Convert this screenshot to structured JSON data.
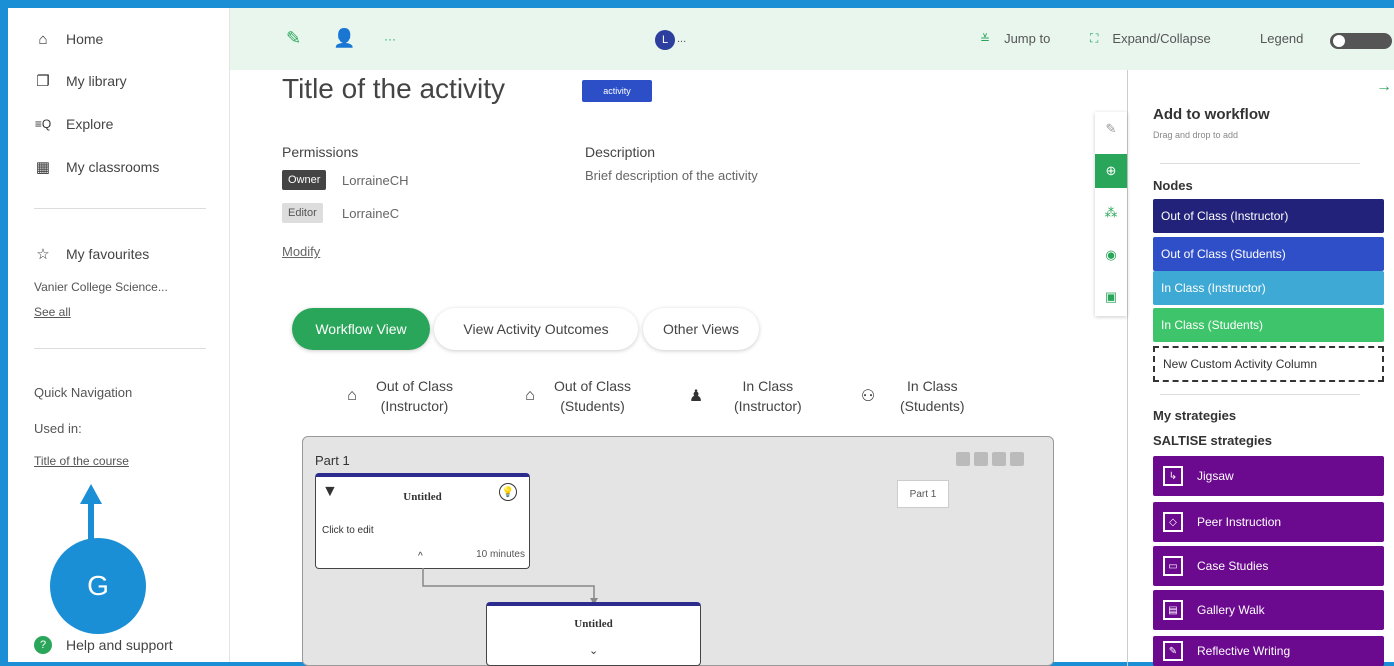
{
  "sidebar": {
    "items": [
      {
        "label": "Home",
        "icon": "home-icon"
      },
      {
        "label": "My library",
        "icon": "library-icon"
      },
      {
        "label": "Explore",
        "icon": "explore-icon"
      },
      {
        "label": "My classrooms",
        "icon": "calendar-icon"
      }
    ],
    "favourites_label": "My favourites",
    "favourite_item": "Vanier College Science...",
    "see_all": "See all",
    "quick_nav": "Quick Navigation",
    "used_in": "Used in:",
    "course_link": "Title of the course",
    "help": "Help and support"
  },
  "callout": {
    "letter": "G"
  },
  "toolbar": {
    "avatar_letter": "L",
    "avatar_more": "...",
    "jump_to": "Jump to",
    "expand_collapse": "Expand/Collapse",
    "legend": "Legend"
  },
  "main": {
    "title": "Title of the activity",
    "badge": "activity",
    "permissions_label": "Permissions",
    "description_label": "Description",
    "description": "Brief description of the activity",
    "owner_role": "Owner",
    "owner_name": "LorraineCH",
    "editor_role": "Editor",
    "editor_name": "LorraineC",
    "modify": "Modify",
    "tabs": [
      "Workflow View",
      "View Activity Outcomes",
      "Other Views"
    ],
    "columns": [
      {
        "line1": "Out of Class",
        "line2": "(Instructor)"
      },
      {
        "line1": "Out of Class",
        "line2": "(Students)"
      },
      {
        "line1": "In Class",
        "line2": "(Instructor)"
      },
      {
        "line1": "In Class",
        "line2": "(Students)"
      }
    ]
  },
  "canvas": {
    "part_title": "Part 1",
    "part_label": "Part 1",
    "node1": {
      "title": "Untitled",
      "body": "Click to edit",
      "time": "10 minutes"
    },
    "node2": {
      "title": "Untitled"
    }
  },
  "panel": {
    "title": "Add to workflow",
    "subtitle": "Drag and drop to add",
    "nodes_heading": "Nodes",
    "nodes": [
      {
        "label": "Out of Class (Instructor)",
        "color": "#22227a"
      },
      {
        "label": "Out of Class (Students)",
        "color": "#2f4fc8"
      },
      {
        "label": "In Class (Instructor)",
        "color": "#3fa9d6"
      },
      {
        "label": "In Class (Students)",
        "color": "#3ec46a"
      }
    ],
    "custom_column": "New Custom Activity Column",
    "my_strategies": "My strategies",
    "saltise": "SALTISE strategies",
    "strategies": [
      "Jigsaw",
      "Peer Instruction",
      "Case Studies",
      "Gallery Walk",
      "Reflective Writing"
    ]
  }
}
